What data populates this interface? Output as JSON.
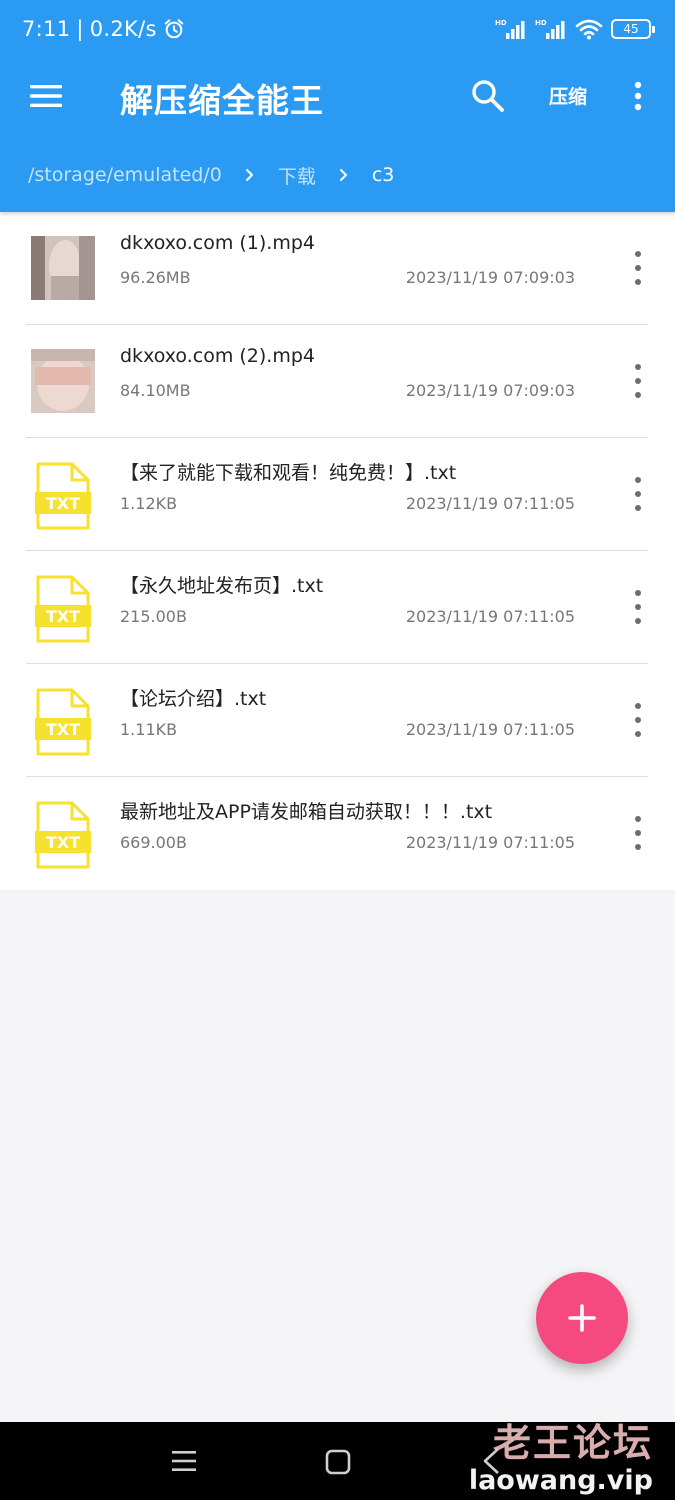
{
  "status_bar": {
    "time": "7:11",
    "net_speed": "0.2K/s",
    "battery": "45"
  },
  "app_bar": {
    "title": "解压缩全能王",
    "compress_label": "压缩"
  },
  "breadcrumb": {
    "items": [
      "/storage/emulated/0",
      "下载",
      "c3"
    ]
  },
  "files": [
    {
      "name": "dkxoxo.com (1).mp4",
      "size": "96.26MB",
      "date": "2023/11/19 07:09:03",
      "type": "video"
    },
    {
      "name": "dkxoxo.com (2).mp4",
      "size": "84.10MB",
      "date": "2023/11/19 07:09:03",
      "type": "video"
    },
    {
      "name": "【来了就能下载和观看！纯免费！】.txt",
      "size": "1.12KB",
      "date": "2023/11/19 07:11:05",
      "type": "txt"
    },
    {
      "name": "【永久地址发布页】.txt",
      "size": "215.00B",
      "date": "2023/11/19 07:11:05",
      "type": "txt"
    },
    {
      "name": "【论坛介绍】.txt",
      "size": "1.11KB",
      "date": "2023/11/19 07:11:05",
      "type": "txt"
    },
    {
      "name": "最新地址及APP请发邮箱自动获取！！！.txt",
      "size": "669.00B",
      "date": "2023/11/19 07:11:05",
      "type": "txt"
    }
  ],
  "txt_icon_label": "TXT",
  "fab_icon": "plus-icon",
  "watermark": {
    "cn": "老王论坛",
    "en": "laowang.vip"
  },
  "colors": {
    "primary": "#2b9af3",
    "fab": "#f54a7f",
    "txt_icon": "#f5e12e"
  }
}
